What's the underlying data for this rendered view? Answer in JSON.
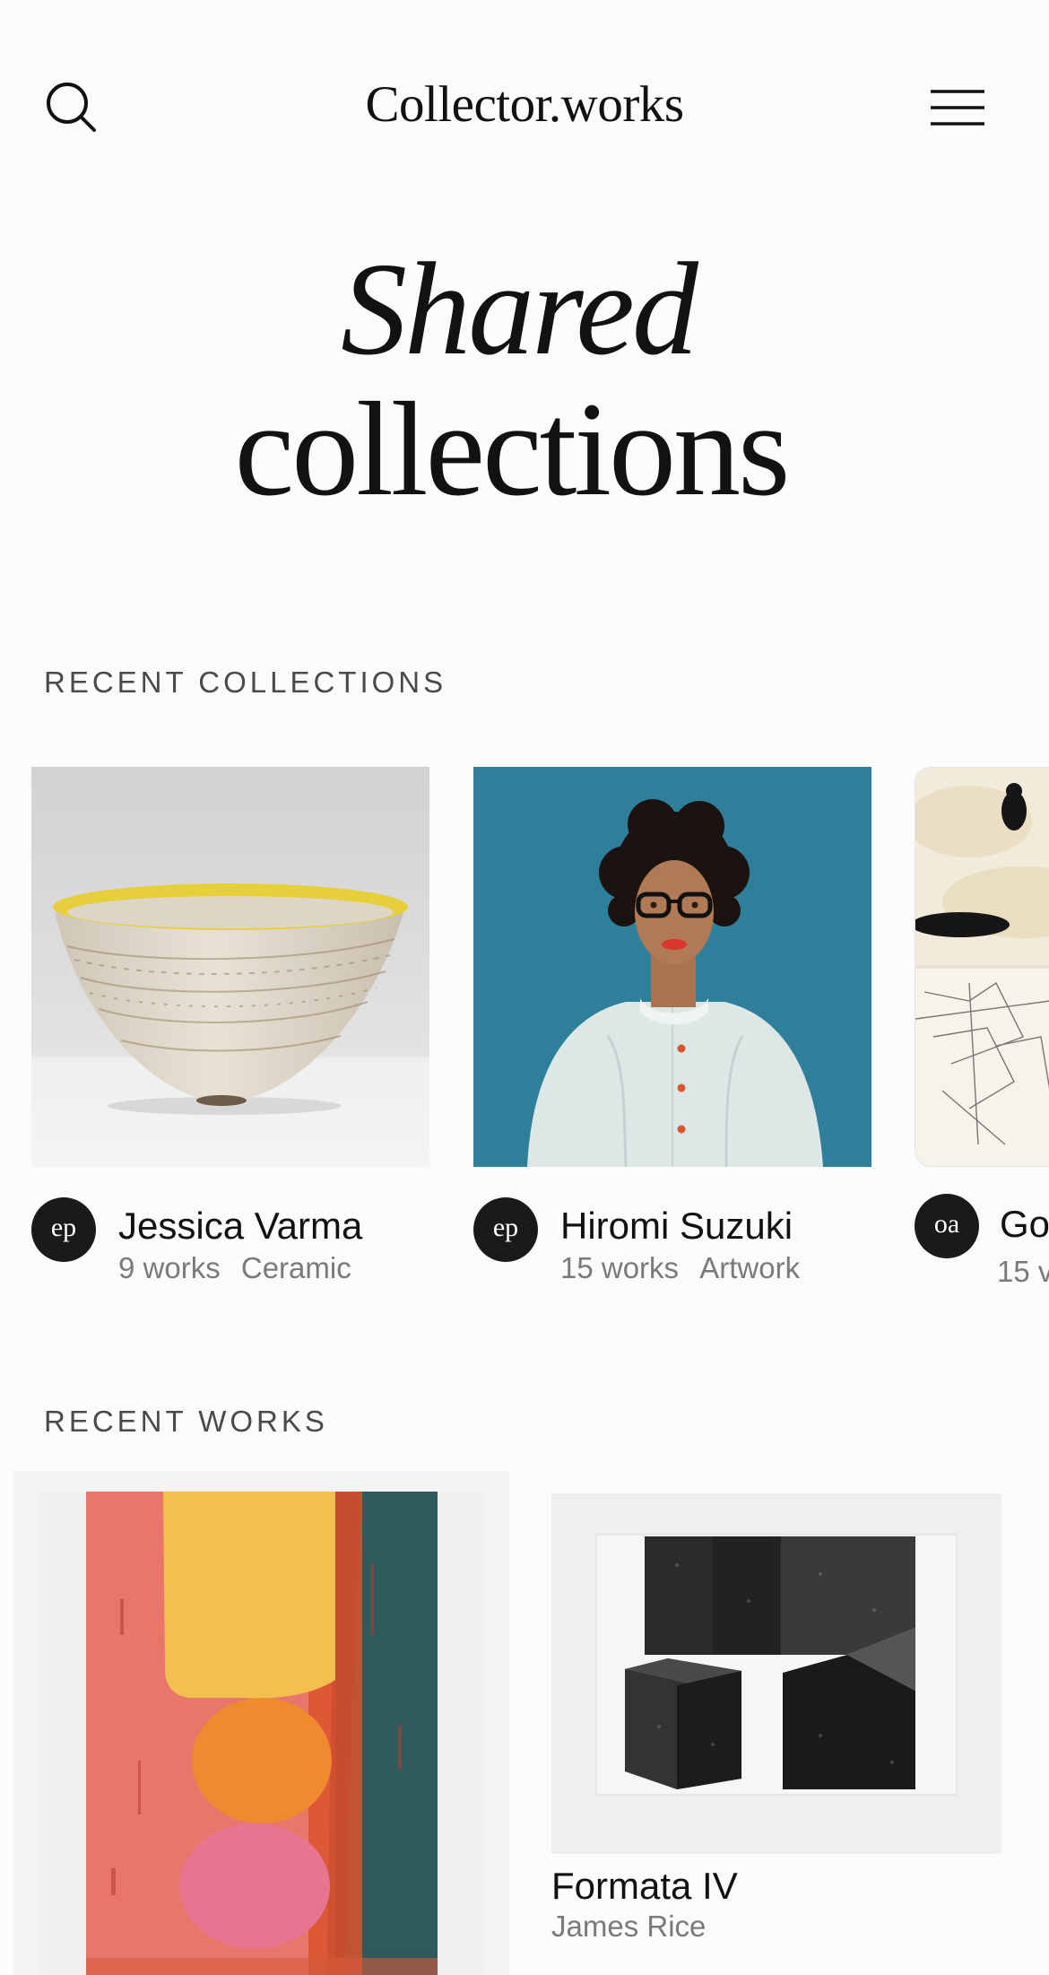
{
  "header": {
    "brand": "Collector.works",
    "search_icon": "search-icon",
    "menu_icon": "hamburger-menu-icon"
  },
  "hero": {
    "line1": "Shared",
    "line2": "collections"
  },
  "sections": {
    "recent_collections": "RECENT COLLECTIONS",
    "recent_works": "RECENT WORKS"
  },
  "collections": [
    {
      "avatar_initials": "ep",
      "owner": "Jessica Varma",
      "count": "9 works",
      "category": "Ceramic",
      "image": "ceramic bowl with yellow rim"
    },
    {
      "avatar_initials": "ep",
      "owner": "Hiromi Suzuki",
      "count": "15 works",
      "category": "Artwork",
      "image": "portrait of woman with glasses on teal background"
    },
    {
      "avatar_initials": "oa",
      "owner": "Go",
      "count": "15 v",
      "category": "",
      "image": "abstract ink and line drawings"
    }
  ],
  "works": [
    {
      "title": "",
      "artist": "",
      "image": "abstract print with coral, yellow, orange and pink forms"
    },
    {
      "title": "Formata IV",
      "artist": "James Rice",
      "image": "grainy black geometric cubes print"
    }
  ],
  "colors": {
    "background": "#fbfbfb",
    "text": "#111111",
    "muted": "#7a7a7a",
    "label": "#4a4a4a",
    "avatar": "#1a1a1a",
    "teal": "#2e7f9a",
    "coral": "#e9766a"
  }
}
